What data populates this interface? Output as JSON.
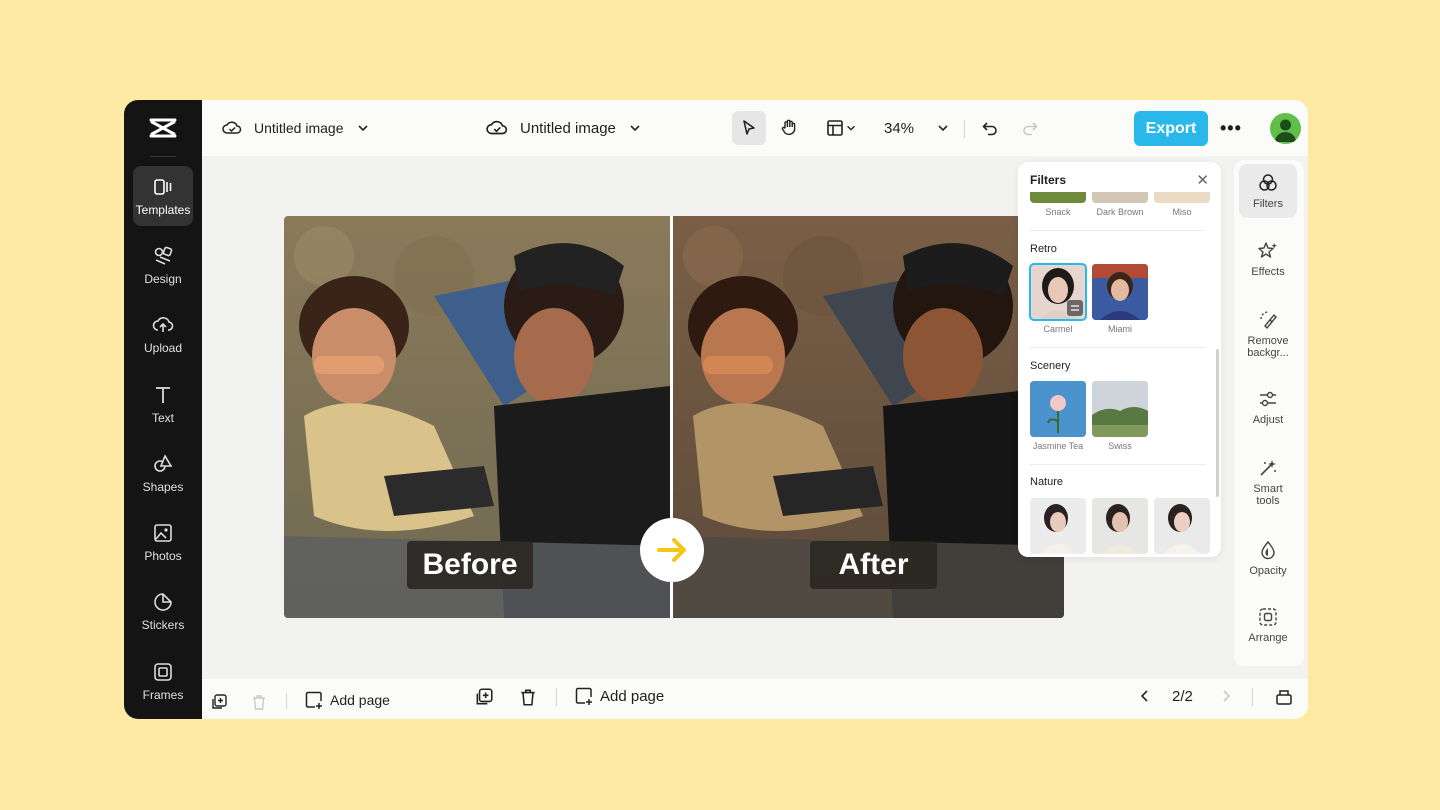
{
  "sidebar": {
    "items": [
      {
        "label": "Templates",
        "icon": "templates-icon"
      },
      {
        "label": "Design",
        "icon": "design-icon"
      },
      {
        "label": "Upload",
        "icon": "upload-icon"
      },
      {
        "label": "Text",
        "icon": "text-icon"
      },
      {
        "label": "Shapes",
        "icon": "shapes-icon"
      },
      {
        "label": "Photos",
        "icon": "photos-icon"
      },
      {
        "label": "Stickers",
        "icon": "stickers-icon"
      },
      {
        "label": "Frames",
        "icon": "frames-icon"
      }
    ]
  },
  "topbar": {
    "doc_title_1": "Untitled image",
    "doc_title_2": "Untitled image",
    "zoom": "34%",
    "export_label": "Export",
    "more_label": "•••"
  },
  "canvas": {
    "before_label": "Before",
    "after_label": "After"
  },
  "filters_panel": {
    "title": "Filters",
    "top_row": [
      "Snack",
      "Dark Brown",
      "Miso"
    ],
    "sections": [
      {
        "name": "Retro",
        "items": [
          "Carmel",
          "Miami"
        ]
      },
      {
        "name": "Scenery",
        "items": [
          "Jasmine Tea",
          "Swiss"
        ]
      },
      {
        "name": "Nature",
        "items": []
      }
    ]
  },
  "right_tools": [
    {
      "label": "Filters",
      "icon": "filters-icon"
    },
    {
      "label": "Effects",
      "icon": "effects-icon"
    },
    {
      "label": "Remove backgr...",
      "icon": "remove-background-icon"
    },
    {
      "label": "Adjust",
      "icon": "adjust-icon"
    },
    {
      "label": "Smart tools",
      "icon": "smart-tools-icon"
    },
    {
      "label": "Opacity",
      "icon": "opacity-icon"
    },
    {
      "label": "Arrange",
      "icon": "arrange-icon"
    }
  ],
  "bottombar": {
    "add_page_1": "Add page",
    "add_page_2": "Add page",
    "page_indicator": "2/2"
  },
  "colors": {
    "background": "#ffeaa4",
    "accent": "#2ab8ea",
    "sidebar": "#141414",
    "arrow": "#f5c518"
  }
}
